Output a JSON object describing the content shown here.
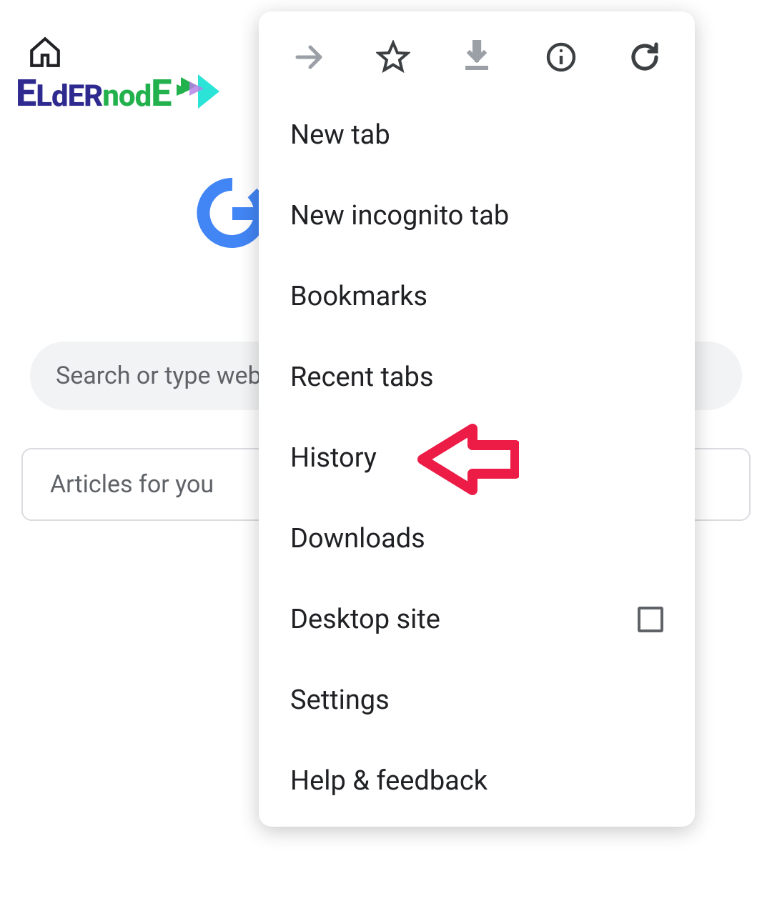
{
  "logo_text": "ELdERnodE",
  "search_placeholder": "Search or type web address",
  "articles_label": "Articles for you",
  "menu": {
    "items": [
      {
        "label": "New tab"
      },
      {
        "label": "New incognito tab"
      },
      {
        "label": "Bookmarks"
      },
      {
        "label": "Recent tabs"
      },
      {
        "label": "History"
      },
      {
        "label": "Downloads"
      },
      {
        "label": "Desktop site",
        "checkbox": true
      },
      {
        "label": "Settings"
      },
      {
        "label": "Help & feedback"
      }
    ]
  },
  "annotation": {
    "arrow_color": "#ed1c47",
    "points_to": "History"
  },
  "colors": {
    "text_primary": "#202124",
    "text_secondary": "#5f6368",
    "border": "#dadce0",
    "search_bg": "#f1f3f4",
    "logo_purple": "#2e2a8f",
    "logo_green": "#22b14c",
    "google_blue": "#4285f4"
  }
}
